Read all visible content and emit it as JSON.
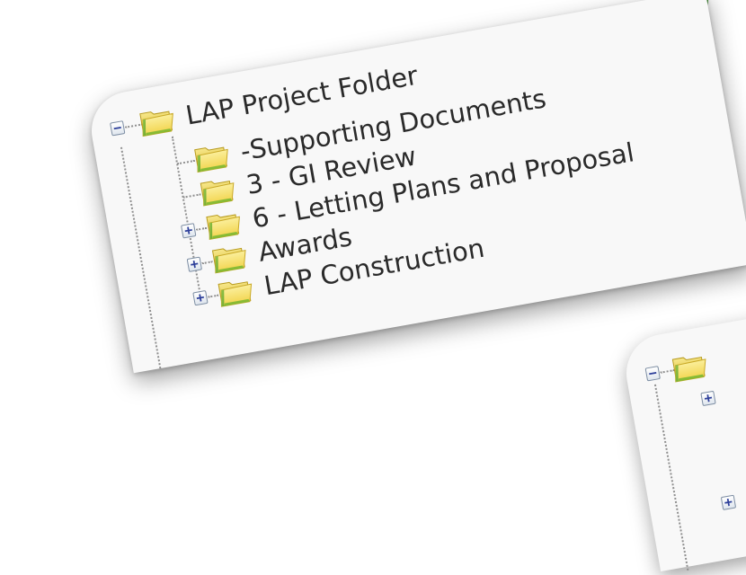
{
  "tree": {
    "root": {
      "label": "LAP Project Folder",
      "expanded": true
    },
    "children": [
      {
        "label": "-Supporting Documents",
        "expandable": false
      },
      {
        "label": "3 - GI Review",
        "expandable": false
      },
      {
        "label": "6 - Letting Plans and Proposal",
        "expandable": true
      },
      {
        "label": "Awards",
        "expandable": true
      },
      {
        "label": "LAP Construction",
        "expandable": true
      }
    ]
  },
  "icons": {
    "collapse": "minus-box",
    "expand": "plus-box",
    "folder": "open-folder-icon"
  },
  "colors": {
    "tree_text": "#2a2a2a",
    "folder_yellow": "#f4dc66",
    "folder_green": "#79b432",
    "expander_sign": "#2d3f9a",
    "accent_green": "#3d8c2e"
  }
}
